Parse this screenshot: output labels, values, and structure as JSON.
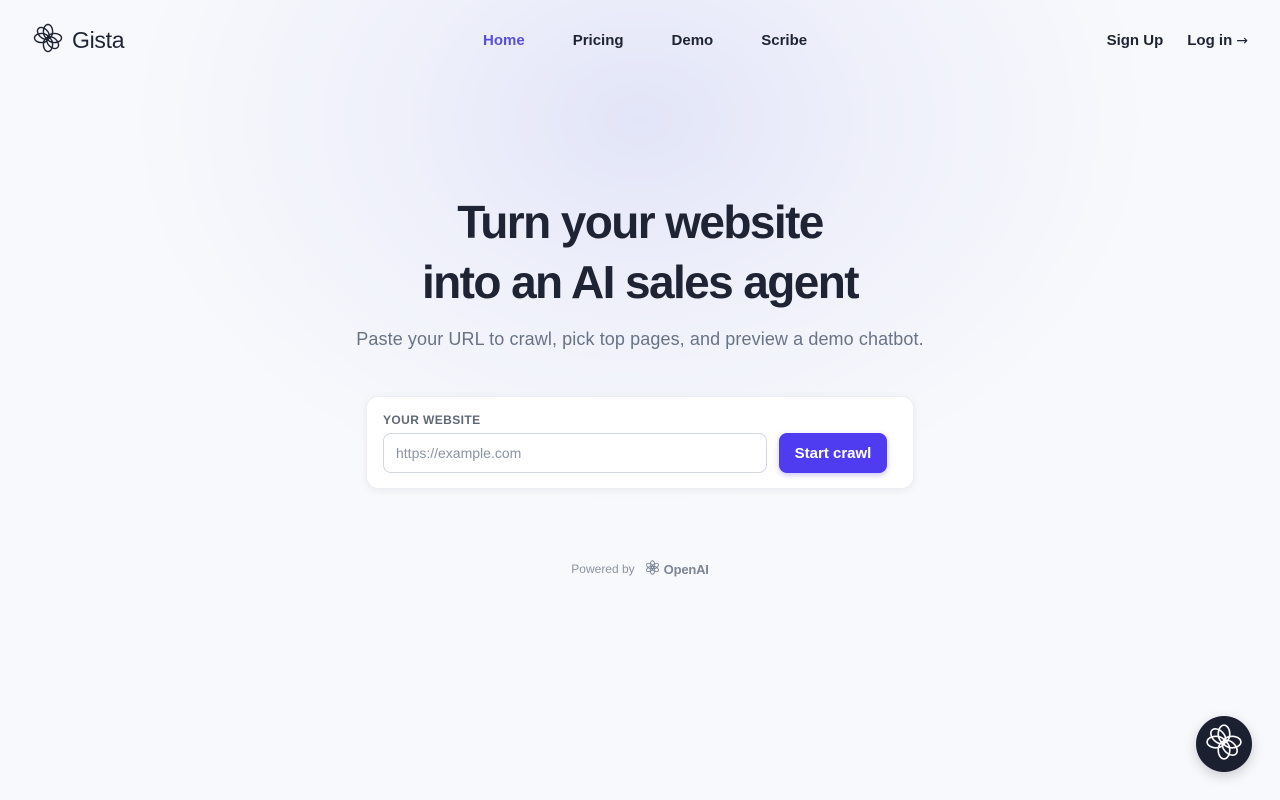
{
  "brand": {
    "name": "Gista",
    "logo_icon": "flower-icon"
  },
  "nav": {
    "items": [
      {
        "label": "Home",
        "active": true
      },
      {
        "label": "Pricing",
        "active": false
      },
      {
        "label": "Demo",
        "active": false
      },
      {
        "label": "Scribe",
        "active": false
      }
    ],
    "active_color": "#5a4fd8"
  },
  "auth": {
    "signup_label": "Sign Up",
    "login_label": "Log in",
    "login_icon": "arrow-right-icon"
  },
  "hero": {
    "title_line1": "Turn your website",
    "title_line2": "into an AI sales agent",
    "subtitle": "Paste your URL to crawl, pick top pages, and preview a demo chatbot."
  },
  "form": {
    "label": "YOUR WEBSITE",
    "url_value": "",
    "url_placeholder": "https://example.com",
    "submit_label": "Start crawl",
    "accent": "#4f3bf0"
  },
  "footer": {
    "powered_by": "Powered by",
    "provider": "OpenAI",
    "provider_icon": "openai-icon"
  },
  "chat_launcher": {
    "icon": "flower-icon",
    "background": "#1a2030"
  }
}
